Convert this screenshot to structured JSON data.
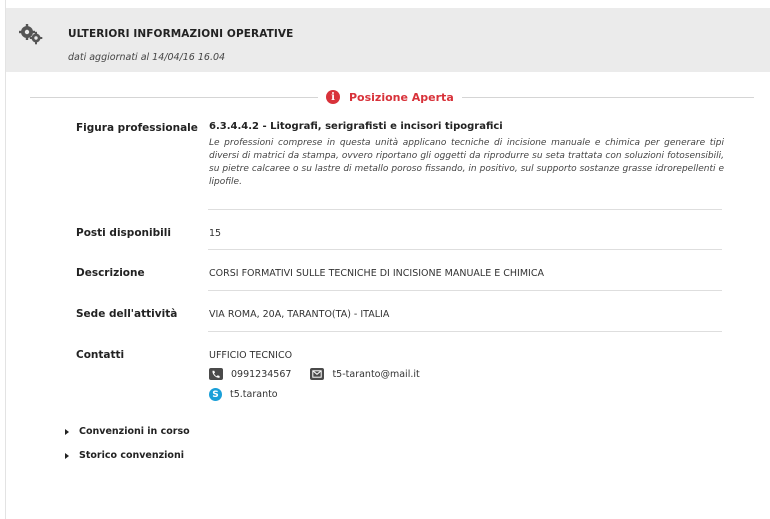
{
  "header": {
    "title": "ULTERIORI INFORMAZIONI OPERATIVE",
    "updated": "dati aggiornati al 14/04/16 16.04"
  },
  "status": {
    "text": "Posizione Aperta",
    "color": "#d8323a",
    "icon": "info-icon"
  },
  "details": {
    "figura": {
      "label": "Figura professionale",
      "title": "6.3.4.4.2 - Litografi, serigrafisti e incisori tipografici",
      "description": "Le professioni comprese in questa unità applicano tecniche di incisione manuale e chimica per generare tipi diversi di matrici da stampa, ovvero riportano gli oggetti da riprodurre su seta trattata con soluzioni fotosensibili, su pietre calcaree o su lastre di metallo poroso fissando, in positivo, sul supporto sostanze grasse idrorepellenti e lipofile."
    },
    "posti": {
      "label": "Posti disponibili",
      "value": "15"
    },
    "descrizione": {
      "label": "Descrizione",
      "value": "CORSI FORMATIVI SULLE TECNICHE DI INCISIONE MANUALE E CHIMICA"
    },
    "sede": {
      "label": "Sede dell'attività",
      "value": "VIA ROMA, 20A, TARANTO(TA) - ITALIA"
    },
    "contatti": {
      "label": "Contatti",
      "office": "UFFICIO TECNICO",
      "phone": "0991234567",
      "email": "t5-taranto@mail.it",
      "skype": "t5.taranto"
    }
  },
  "accordions": [
    {
      "label": "Convenzioni in corso"
    },
    {
      "label": "Storico convenzioni"
    }
  ]
}
